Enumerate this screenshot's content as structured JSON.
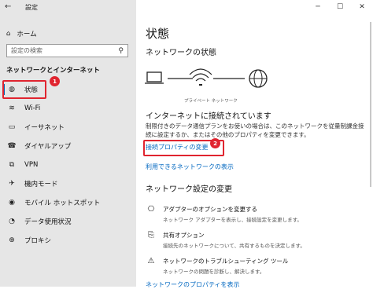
{
  "window": {
    "title": "設定",
    "controls": [
      "─",
      "☐",
      "✕"
    ]
  },
  "sidebar": {
    "home_label": "ホーム",
    "search_placeholder": "設定の検索",
    "section_title": "ネットワークとインターネット",
    "items": [
      {
        "label": "状態",
        "icon": "globe-icon"
      },
      {
        "label": "Wi-Fi",
        "icon": "wifi-icon"
      },
      {
        "label": "イーサネット",
        "icon": "ethernet-icon"
      },
      {
        "label": "ダイヤルアップ",
        "icon": "phone-icon"
      },
      {
        "label": "VPN",
        "icon": "vpn-icon"
      },
      {
        "label": "機内モード",
        "icon": "airplane-icon"
      },
      {
        "label": "モバイル ホットスポット",
        "icon": "hotspot-icon"
      },
      {
        "label": "データ使用状況",
        "icon": "data-usage-icon"
      },
      {
        "label": "プロキシ",
        "icon": "proxy-icon"
      }
    ]
  },
  "main": {
    "page_title": "状態",
    "network_status_heading": "ネットワークの状態",
    "network_caption": "プライベート ネットワーク",
    "connected_title": "インターネットに接続されています",
    "connected_desc": "制限付きのデータ通信プランをお使いの場合は、このネットワークを従量制課金接続に設定するか、またはその他のプロパティを変更できます。",
    "change_properties_link": "接続プロパティの変更",
    "show_networks_link": "利用できるネットワークの表示",
    "settings_heading": "ネットワーク設定の変更",
    "options": [
      {
        "title": "アダプターのオプションを変更する",
        "desc": "ネットワーク アダプターを表示し、接続設定を変更します。",
        "icon": "adapter-icon"
      },
      {
        "title": "共有オプション",
        "desc": "接続先のネットワークについて、共有するものを決定します。",
        "icon": "sharing-icon"
      },
      {
        "title": "ネットワークのトラブルシューティング ツール",
        "desc": "ネットワークの問題を診断し、解決します。",
        "icon": "warning-icon"
      }
    ],
    "properties_link": "ネットワークのプロパティを表示"
  },
  "annotations": {
    "badge1": "1",
    "badge2": "2"
  },
  "colors": {
    "accent": "#0063b1",
    "link": "#0067c0",
    "highlight": "#e0242f",
    "sidebar_bg": "#e6e6e6"
  }
}
